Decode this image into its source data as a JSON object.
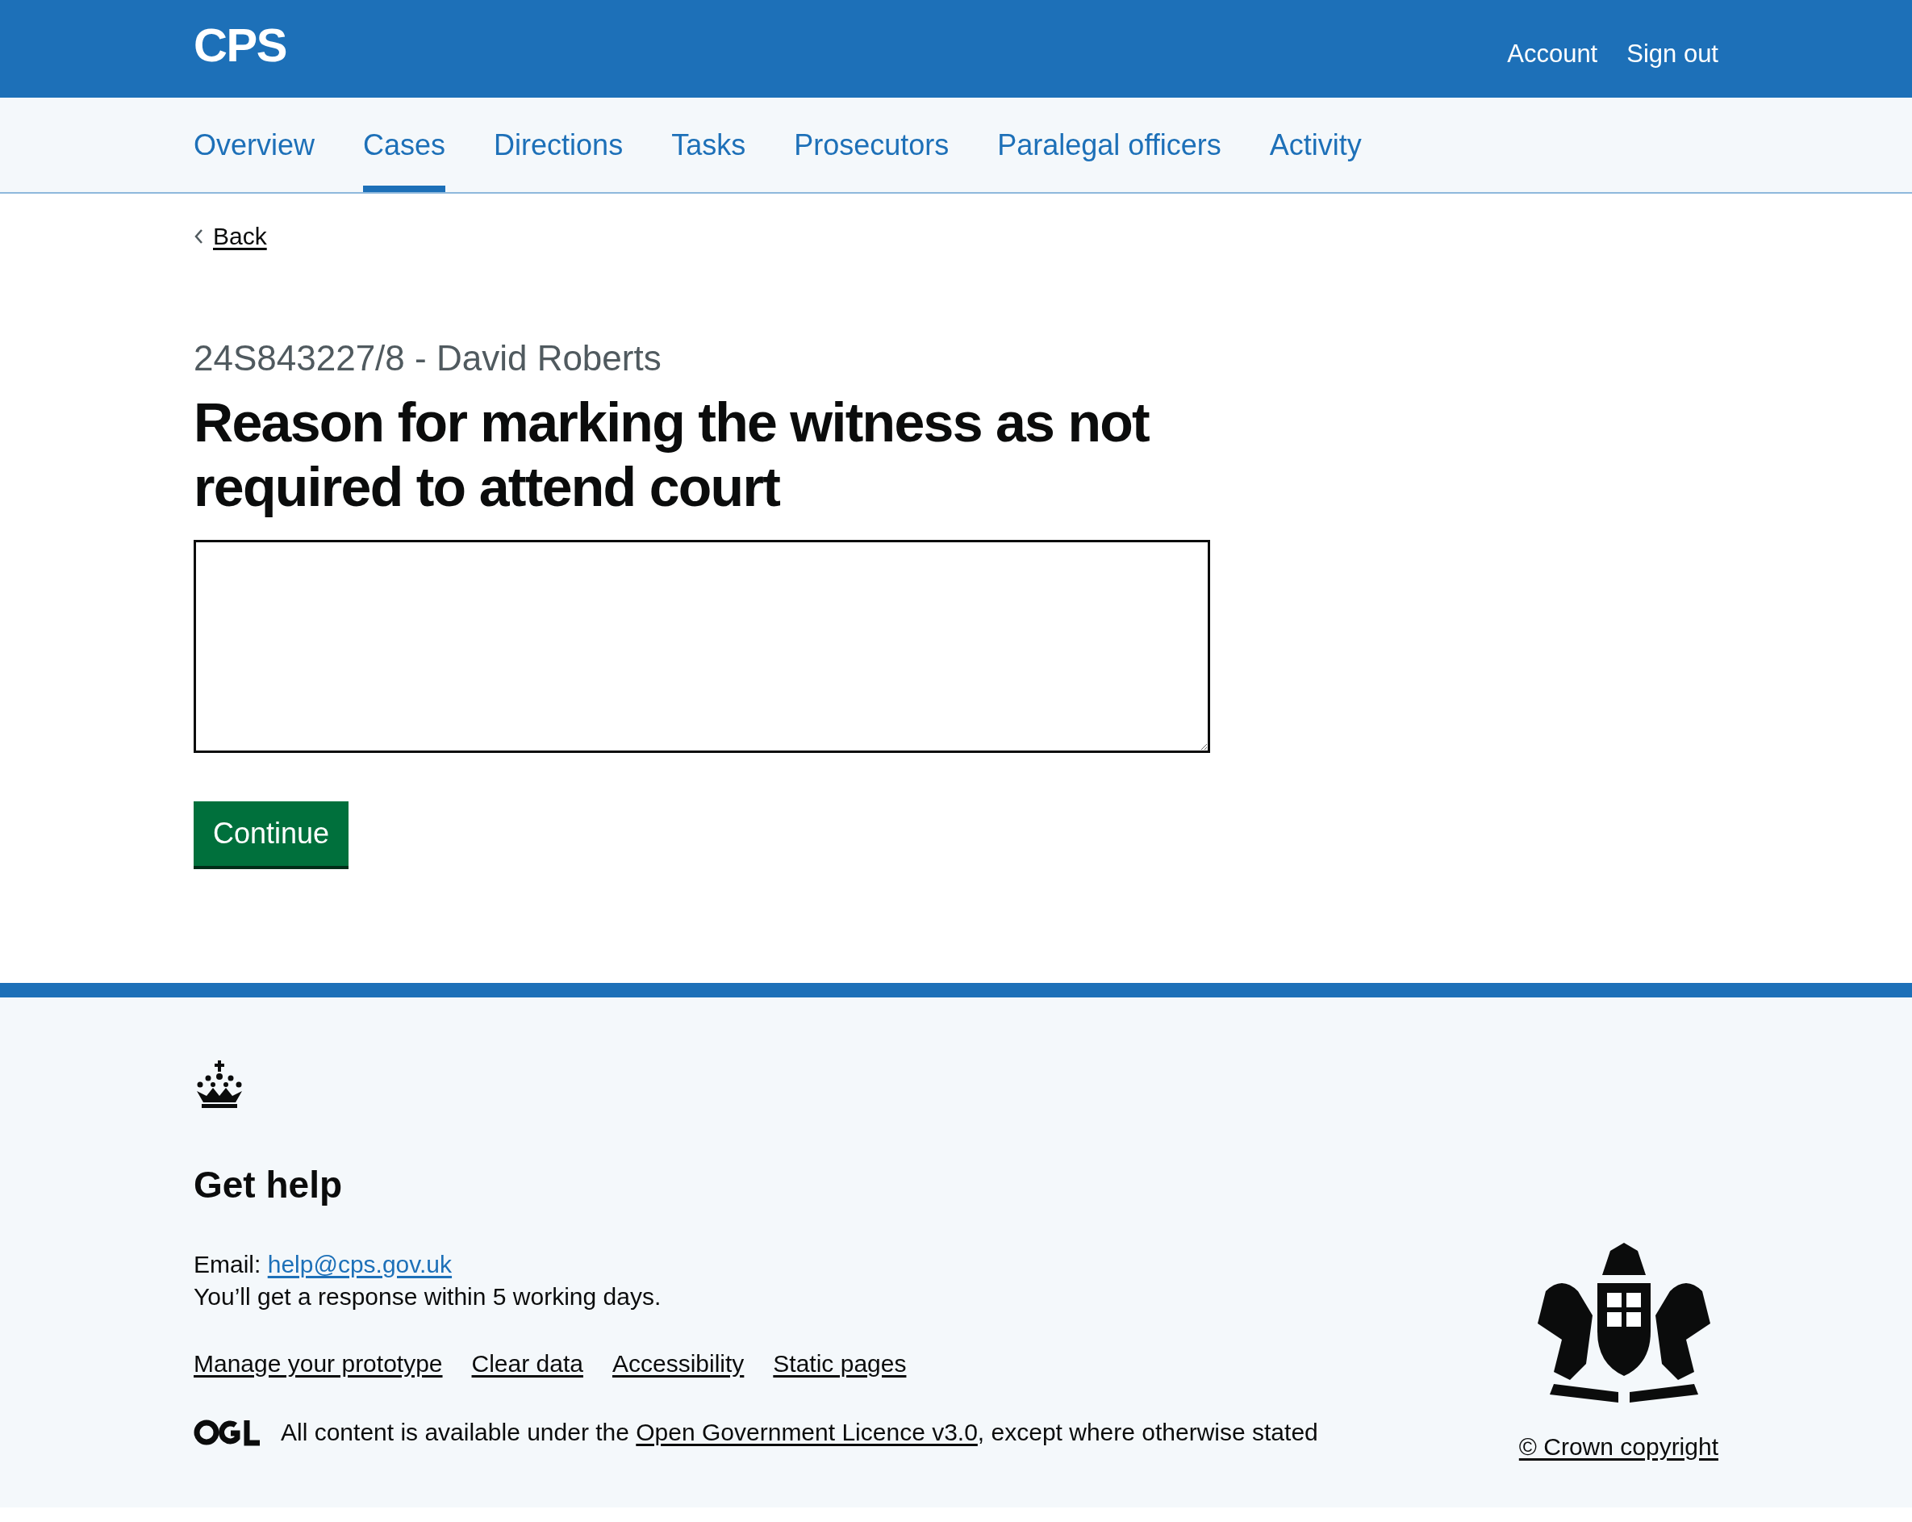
{
  "header": {
    "logo": "CPS",
    "links": [
      "Account",
      "Sign out"
    ]
  },
  "nav": [
    {
      "label": "Overview",
      "selected": false
    },
    {
      "label": "Cases",
      "selected": true
    },
    {
      "label": "Directions",
      "selected": false
    },
    {
      "label": "Tasks",
      "selected": false
    },
    {
      "label": "Prosecutors",
      "selected": false
    },
    {
      "label": "Paralegal officers",
      "selected": false
    },
    {
      "label": "Activity",
      "selected": false
    }
  ],
  "back_link": "Back",
  "caption": "24S843227/8 - David Roberts",
  "heading": "Reason for marking the witness as not required to attend court",
  "continue_button": "Continue",
  "footer": {
    "heading": "Get help",
    "email_label": "Email:",
    "email": "help@cps.gov.uk",
    "response": "You’ll get a response within 5 working days.",
    "links": [
      "Manage your prototype",
      "Clear data",
      "Accessibility",
      "Static pages"
    ],
    "licence_before": "All content is available under the ",
    "licence_link": "Open Government Licence v3.0",
    "licence_after": ", except where otherwise stated",
    "copyright": "© Crown copyright"
  }
}
